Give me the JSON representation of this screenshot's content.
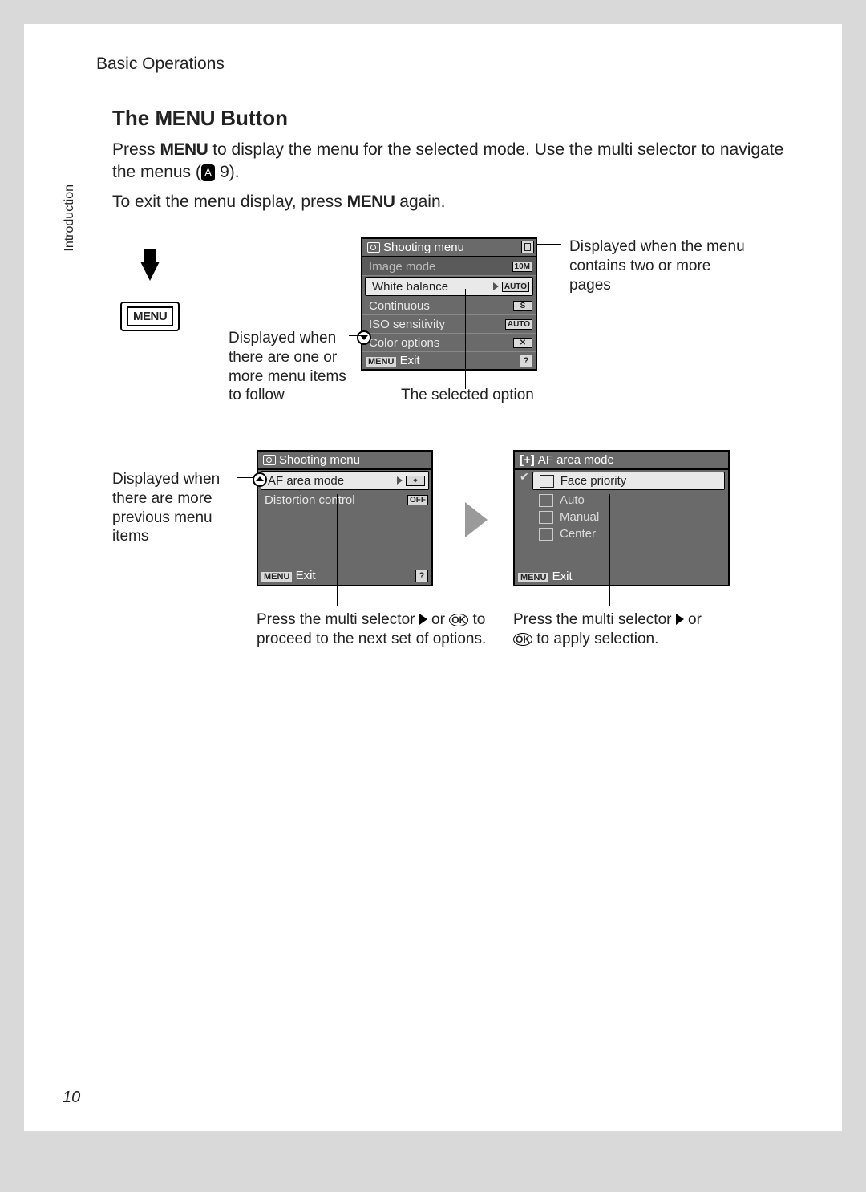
{
  "header": {
    "section": "Basic Operations"
  },
  "sideTab": "Introduction",
  "pageNumber": "10",
  "title": {
    "prefix": "The ",
    "menuWord": "MENU",
    "suffix": " Button"
  },
  "intro": {
    "line1a": "Press ",
    "menuWord": "MENU",
    "line1b": " to display the menu for the selected mode. Use the multi selector to navigate the menus (",
    "refIcon": "A",
    "refNum": " 9).",
    "line2a": "To exit the menu display, press ",
    "line2b": " again."
  },
  "menuButtonLabel": "MENU",
  "lcd1": {
    "title": "Shooting menu",
    "items": [
      {
        "label": "Image mode",
        "badge": "10M"
      },
      {
        "label": "White balance",
        "badge": "AUTO",
        "selected": true
      },
      {
        "label": "Continuous",
        "badge": "S"
      },
      {
        "label": "ISO sensitivity",
        "badge": "AUTO"
      },
      {
        "label": "Color options",
        "badge": "✕"
      }
    ],
    "exitChip": "MENU",
    "exitText": "Exit",
    "help": "?"
  },
  "lcd2": {
    "title": "Shooting menu",
    "items": [
      {
        "label": "AF area mode",
        "badge": "⌖",
        "selected": true
      },
      {
        "label": "Distortion control",
        "badge": "OFF"
      }
    ],
    "exitChip": "MENU",
    "exitText": "Exit",
    "help": "?"
  },
  "lcd3": {
    "title": "AF area mode",
    "options": [
      {
        "label": "Face priority",
        "selected": true,
        "checked": true
      },
      {
        "label": "Auto"
      },
      {
        "label": "Manual"
      },
      {
        "label": "Center"
      }
    ],
    "exitChip": "MENU",
    "exitText": "Exit"
  },
  "callouts": {
    "morePages": "Displayed when the menu contains two or more pages",
    "moreFollow": "Displayed when there are one or more menu items to follow",
    "selectedOption": "The selected option",
    "morePrevious": "Displayed when there are more previous menu items",
    "proceedA": "Press the multi selector ",
    "proceedB": " or ",
    "proceedC": " to proceed to the next set of options.",
    "applyA": "Press the multi selector ",
    "applyB": " or ",
    "applyC": " to apply selection.",
    "ok": "OK"
  }
}
